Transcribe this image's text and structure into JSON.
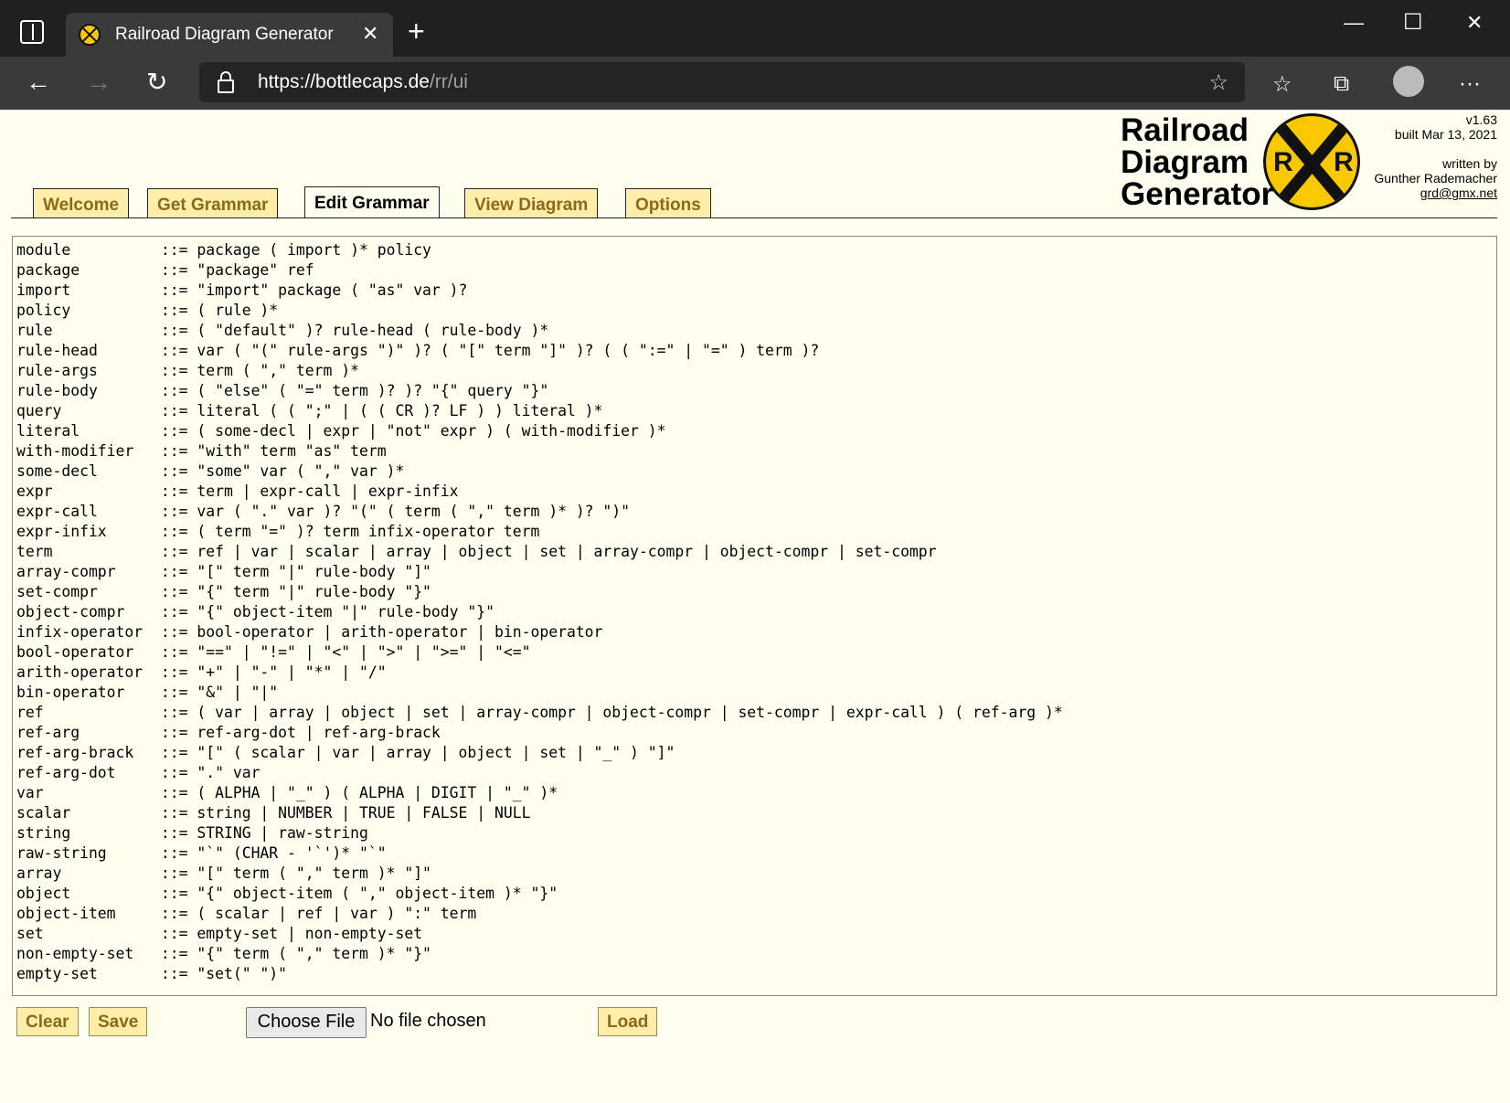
{
  "browser": {
    "tab_title": "Railroad Diagram Generator",
    "tab_close": "✕",
    "new_tab": "+",
    "url_prefix": "https://",
    "url_host": "bottlecaps.de",
    "url_path": "/rr/ui",
    "window_controls": {
      "minimize": "—",
      "maximize": "☐",
      "close": "✕"
    },
    "nav": {
      "back": "←",
      "forward": "→",
      "reload": "↻"
    },
    "toolbar_icons": {
      "add_favorite": "☆",
      "favorites": "☆",
      "collections": "⧉",
      "more": "···"
    }
  },
  "header": {
    "logo_line1": "Railroad",
    "logo_line2": "Diagram",
    "logo_line3": "Generator",
    "logo_letter": "R",
    "version": "v1.63",
    "built": "built Mar 13, 2021",
    "written_by": "written by",
    "author": "Gunther Rademacher",
    "email": "grd@gmx.net"
  },
  "tabs": [
    "Welcome",
    "Get Grammar",
    "Edit Grammar",
    "View Diagram",
    "Options"
  ],
  "active_tab": "Edit Grammar",
  "grammar_lines": [
    "module          ::= package ( import )* policy",
    "package         ::= \"package\" ref",
    "import          ::= \"import\" package ( \"as\" var )?",
    "policy          ::= ( rule )*",
    "rule            ::= ( \"default\" )? rule-head ( rule-body )*",
    "rule-head       ::= var ( \"(\" rule-args \")\" )? ( \"[\" term \"]\" )? ( ( \":=\" | \"=\" ) term )?",
    "rule-args       ::= term ( \",\" term )*",
    "rule-body       ::= ( \"else\" ( \"=\" term )? )? \"{\" query \"}\"",
    "query           ::= literal ( ( \";\" | ( ( CR )? LF ) ) literal )*",
    "literal         ::= ( some-decl | expr | \"not\" expr ) ( with-modifier )*",
    "with-modifier   ::= \"with\" term \"as\" term",
    "some-decl       ::= \"some\" var ( \",\" var )*",
    "expr            ::= term | expr-call | expr-infix",
    "expr-call       ::= var ( \".\" var )? \"(\" ( term ( \",\" term )* )? \")\"",
    "expr-infix      ::= ( term \"=\" )? term infix-operator term",
    "term            ::= ref | var | scalar | array | object | set | array-compr | object-compr | set-compr",
    "array-compr     ::= \"[\" term \"|\" rule-body \"]\"",
    "set-compr       ::= \"{\" term \"|\" rule-body \"}\"",
    "object-compr    ::= \"{\" object-item \"|\" rule-body \"}\"",
    "infix-operator  ::= bool-operator | arith-operator | bin-operator",
    "bool-operator   ::= \"==\" | \"!=\" | \"<\" | \">\" | \">=\" | \"<=\"",
    "arith-operator  ::= \"+\" | \"-\" | \"*\" | \"/\"",
    "bin-operator    ::= \"&\" | \"|\"",
    "ref             ::= ( var | array | object | set | array-compr | object-compr | set-compr | expr-call ) ( ref-arg )*",
    "ref-arg         ::= ref-arg-dot | ref-arg-brack",
    "ref-arg-brack   ::= \"[\" ( scalar | var | array | object | set | \"_\" ) \"]\"",
    "ref-arg-dot     ::= \".\" var",
    "var             ::= ( ALPHA | \"_\" ) ( ALPHA | DIGIT | \"_\" )*",
    "scalar          ::= string | NUMBER | TRUE | FALSE | NULL",
    "string          ::= STRING | raw-string",
    "raw-string      ::= \"`\" (CHAR - '`')* \"`\"",
    "array           ::= \"[\" term ( \",\" term )* \"]\"",
    "object          ::= \"{\" object-item ( \",\" object-item )* \"}\"",
    "object-item     ::= ( scalar | ref | var ) \":\" term",
    "set             ::= empty-set | non-empty-set",
    "non-empty-set   ::= \"{\" term ( \",\" term )* \"}\"",
    "empty-set       ::= \"set(\" \")\""
  ],
  "buttons": {
    "clear": "Clear",
    "save": "Save",
    "choose_file": "Choose File",
    "file_status": "No file chosen",
    "load": "Load"
  },
  "colors": {
    "page_bg": "#fffff0",
    "tab_bg": "#ffeeaa",
    "tab_text": "#8a6a1a",
    "logo_yellow": "#f8c800",
    "chrome_dark": "#202020"
  }
}
